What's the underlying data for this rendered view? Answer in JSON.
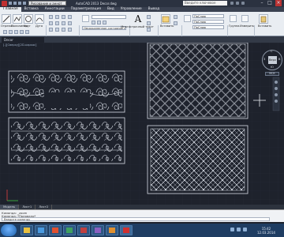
{
  "titlebar": {
    "workspace": "Рисование и аннот",
    "title": "AutoCAD 2013  Decor.dwg",
    "search_placeholder": "Введите ключевое слово/фразу"
  },
  "menu": {
    "tabs": [
      "Главная",
      "Вставка",
      "Аннотации",
      "Параметризация",
      "Вид",
      "Управление",
      "Вывод"
    ],
    "active_index": 0
  },
  "ribbon": {
    "panels": [
      "Рисование",
      "Редактирование",
      "Слои",
      "Аннотации",
      "Блок",
      "Свойства",
      "Группы",
      "Утилиты",
      "Буфер обмена"
    ],
    "draw_tools": [
      "Отрезок",
      "Полилиния",
      "Круг",
      "Дуга"
    ],
    "layer_state": "Несохраненное состояние слоя",
    "text_label": "Многострочный текст",
    "insert_label": "Вставить",
    "properties": {
      "color": "ПоСлою",
      "linetype": "ПоСлою",
      "lineweight": "ПоСлою"
    },
    "groups_label": "Группа",
    "utilities_label": "Измерить",
    "paste_label": "Вставить"
  },
  "file_tab": {
    "label": "Decor"
  },
  "viewport_label": "[-][Сверху][2D-каркас]",
  "viewcube": {
    "top": "Верх",
    "north": "С",
    "south": "Ю",
    "west": "З",
    "east": "В",
    "wcs": "МСК"
  },
  "layout_tabs": [
    "Модель",
    "Лист1",
    "Лист2"
  ],
  "command": {
    "history": [
      "Команда: _zoom",
      "Команда: *Прервано*"
    ],
    "placeholder": "Введите команду"
  },
  "taskbar": {
    "time": "15:42",
    "date": "12.03.2014"
  },
  "colors": {
    "canvas": "#1e222c",
    "grid": "#283040",
    "lines": "#d8dde6",
    "ribbon": "#e9edf2"
  }
}
